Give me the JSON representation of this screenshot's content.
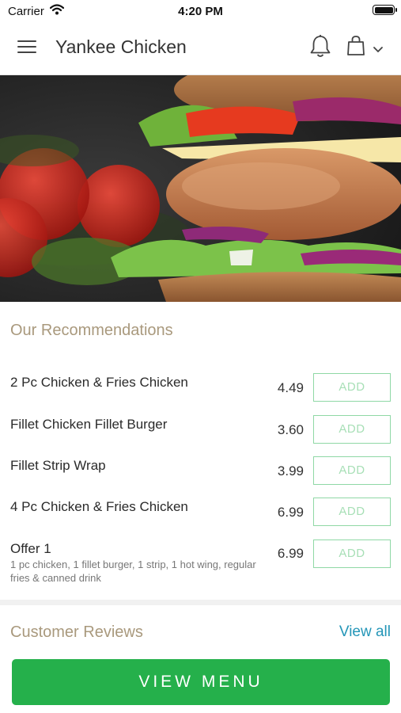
{
  "status_bar": {
    "carrier": "Carrier",
    "time": "4:20 PM"
  },
  "header": {
    "title": "Yankee Chicken"
  },
  "icons": {
    "menu": "hamburger-menu-icon",
    "bell": "bell-icon",
    "bag": "shopping-bag-icon",
    "chevron": "chevron-down-icon",
    "wifi": "wifi-icon",
    "battery": "battery-icon"
  },
  "recommendations": {
    "title": "Our Recommendations",
    "items": [
      {
        "name": "2 Pc Chicken & Fries Chicken",
        "price": "4.49",
        "add_label": "ADD"
      },
      {
        "name": "Fillet Chicken Fillet Burger",
        "price": "3.60",
        "add_label": "ADD"
      },
      {
        "name": "Fillet Strip Wrap",
        "price": "3.99",
        "add_label": "ADD"
      },
      {
        "name": "4 Pc Chicken & Fries Chicken",
        "price": "6.99",
        "add_label": "ADD"
      },
      {
        "name": "Offer 1",
        "description": "1 pc chicken, 1 fillet burger, 1 strip, 1 hot wing, regular fries & canned drink",
        "price": "6.99",
        "add_label": "ADD"
      }
    ]
  },
  "reviews": {
    "title": "Customer Reviews",
    "view_all": "View all"
  },
  "footer": {
    "view_menu_label": "VIEW MENU"
  },
  "colors": {
    "accent_green": "#25b04b",
    "add_border": "#8fd8a5",
    "section_title": "#a9997d",
    "link": "#2496b8"
  }
}
